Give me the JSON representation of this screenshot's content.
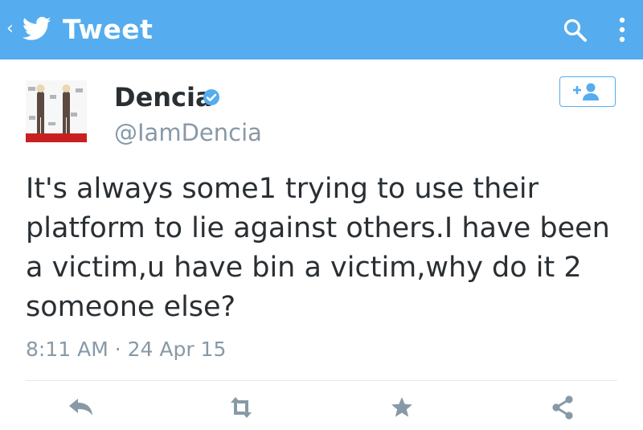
{
  "header": {
    "back_glyph": "‹",
    "title": "Tweet",
    "icons": [
      "twitter-bird-icon",
      "search-icon",
      "more-vert-icon"
    ]
  },
  "tweet": {
    "author_name": "Dencia",
    "handle": "@IamDencia",
    "verified": true,
    "text": "It's always some1 trying to use their platform to lie against others.I have been a victim,u have bin a victim,why do it 2 someone else?",
    "timestamp": "8:11 AM · 24 Apr 15"
  },
  "follow_button": {
    "icon": "add-user-icon"
  },
  "actions": [
    "reply-icon",
    "retweet-icon",
    "favorite-icon",
    "share-icon"
  ],
  "colors": {
    "header_bg": "#55acee",
    "accent": "#55acee",
    "text": "#292f33",
    "secondary_text": "#8899a6",
    "action_icon": "#8899a6"
  }
}
